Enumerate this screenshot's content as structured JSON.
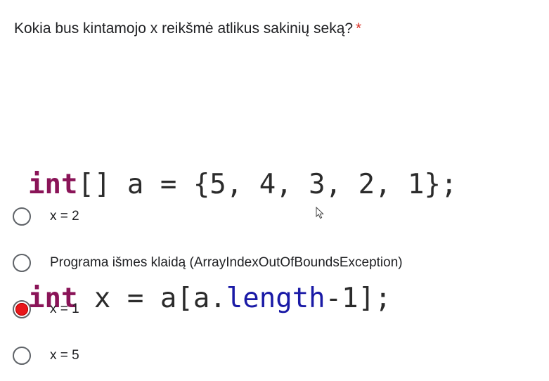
{
  "question": {
    "text": "Kokia bus kintamojo x reikšmė atlikus sakinių seką?",
    "required_mark": "*"
  },
  "code": {
    "line1": {
      "keyword": "int",
      "rest": "[] a = {5, 4, 3, 2, 1};"
    },
    "line2": {
      "keyword": "int",
      "before_member": " x = a[a.",
      "member": "length",
      "after_member": "-1];"
    }
  },
  "options": [
    {
      "label": "x = 2",
      "selected": false
    },
    {
      "label": "Programa išmes klaidą (ArrayIndexOutOfBoundsException)",
      "selected": false
    },
    {
      "label": "x = 1",
      "selected": true
    },
    {
      "label": "x = 5",
      "selected": false
    }
  ],
  "colors": {
    "accent_selected": "#e8171b",
    "required": "#d93025",
    "keyword": "#8a1458",
    "member": "#1a1aa6"
  },
  "icons": {
    "radio": "radio-button-icon",
    "cursor": "mouse-pointer-icon"
  }
}
